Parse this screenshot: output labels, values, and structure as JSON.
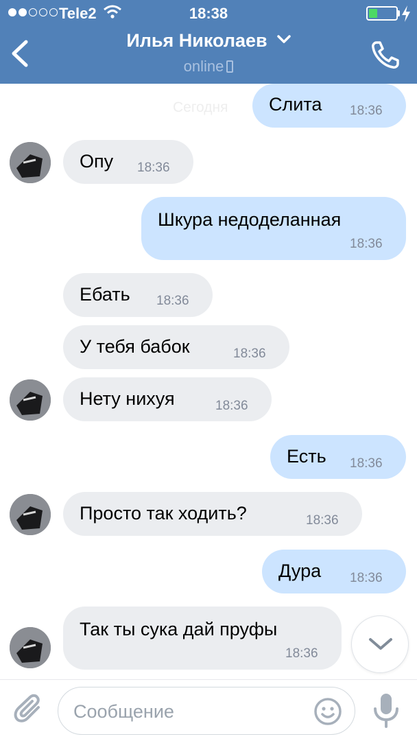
{
  "status_bar": {
    "carrier": "Tele2",
    "time": "18:38"
  },
  "header": {
    "contact_name": "Илья Николаев",
    "status": "online"
  },
  "messages": [
    {
      "dir": "out",
      "text": "Слита",
      "time": "18:36"
    },
    {
      "dir": "in",
      "text": "Опу",
      "time": "18:36"
    },
    {
      "dir": "out",
      "text": "Шкура недоделанная",
      "time": "18:36"
    },
    {
      "dir": "in",
      "text": "Ебать",
      "time": "18:36"
    },
    {
      "dir": "in",
      "text": "У тебя бабок",
      "time": "18:36"
    },
    {
      "dir": "in",
      "text": "Нету нихуя",
      "time": "18:36"
    },
    {
      "dir": "out",
      "text": "Есть",
      "time": "18:36"
    },
    {
      "dir": "in",
      "text": "Просто так ходить?",
      "time": "18:36"
    },
    {
      "dir": "out",
      "text": "Дура",
      "time": "18:36"
    },
    {
      "dir": "in",
      "text": "Так ты сука дай пруфы",
      "time": "18:36"
    }
  ],
  "composer": {
    "placeholder": "Сообщение"
  },
  "icons": {
    "back": "chevron-left-icon",
    "call": "phone-icon",
    "attach": "paperclip-icon",
    "emoji": "smile-icon",
    "mic": "microphone-icon",
    "scroll_down": "chevron-down-icon"
  },
  "colors": {
    "header": "#5181b8",
    "incoming_bubble": "#ebedf0",
    "outgoing_bubble": "#cce4ff",
    "timestamp": "#828a99",
    "battery": "#4cd964"
  }
}
